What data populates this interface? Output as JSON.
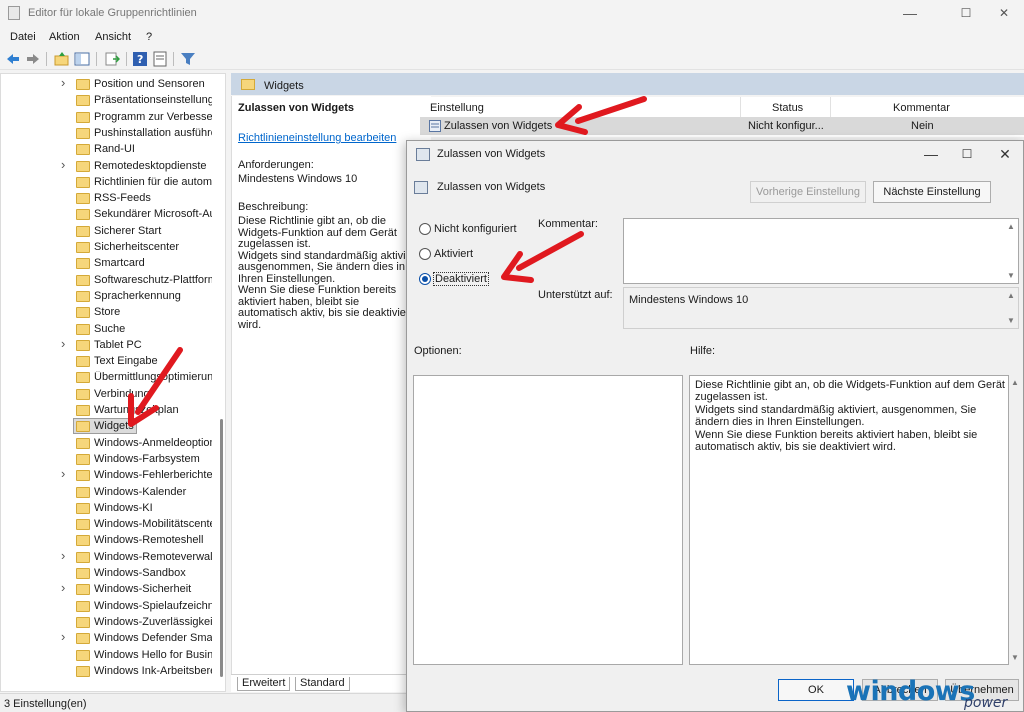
{
  "window": {
    "title": "Editor für lokale Gruppenrichtlinien",
    "minimize": "—",
    "maximize": "☐",
    "close": "✕"
  },
  "menu": {
    "file": "Datei",
    "action": "Aktion",
    "view": "Ansicht",
    "help": "?"
  },
  "tree": {
    "items": [
      {
        "label": "Position und Sensoren",
        "expandable": true
      },
      {
        "label": "Präsentationseinstellungen",
        "expandable": false
      },
      {
        "label": "Programm zur Verbesserung",
        "expandable": false
      },
      {
        "label": "Pushinstallation ausführen",
        "expandable": false
      },
      {
        "label": "Rand-UI",
        "expandable": false
      },
      {
        "label": "Remotedesktopdienste",
        "expandable": true
      },
      {
        "label": "Richtlinien für die automatische",
        "expandable": false
      },
      {
        "label": "RSS-Feeds",
        "expandable": false
      },
      {
        "label": "Sekundärer Microsoft-Authentifikator",
        "expandable": false
      },
      {
        "label": "Sicherer Start",
        "expandable": false
      },
      {
        "label": "Sicherheitscenter",
        "expandable": false
      },
      {
        "label": "Smartcard",
        "expandable": false
      },
      {
        "label": "Softwareschutz-Plattform",
        "expandable": false
      },
      {
        "label": "Spracherkennung",
        "expandable": false
      },
      {
        "label": "Store",
        "expandable": false
      },
      {
        "label": "Suche",
        "expandable": false
      },
      {
        "label": "Tablet PC",
        "expandable": true
      },
      {
        "label": "Text Eingabe",
        "expandable": false
      },
      {
        "label": "Übermittlungsoptimierung",
        "expandable": false
      },
      {
        "label": "Verbindung",
        "expandable": false
      },
      {
        "label": "Wartungszeitplan",
        "expandable": false
      },
      {
        "label": "Widgets",
        "expandable": false,
        "selected": true
      },
      {
        "label": "Windows-Anmeldeoptionen",
        "expandable": false
      },
      {
        "label": "Windows-Farbsystem",
        "expandable": false
      },
      {
        "label": "Windows-Fehlerberichterstattung",
        "expandable": true
      },
      {
        "label": "Windows-Kalender",
        "expandable": false
      },
      {
        "label": "Windows-KI",
        "expandable": false
      },
      {
        "label": "Windows-Mobilitätscenter",
        "expandable": false
      },
      {
        "label": "Windows-Remoteshell",
        "expandable": false
      },
      {
        "label": "Windows-Remoteverwaltung",
        "expandable": true
      },
      {
        "label": "Windows-Sandbox",
        "expandable": false
      },
      {
        "label": "Windows-Sicherheit",
        "expandable": true
      },
      {
        "label": "Windows-Spielaufzeichnung",
        "expandable": false
      },
      {
        "label": "Windows-Zuverlässigkeit",
        "expandable": false
      },
      {
        "label": "Windows Defender SmartScreen",
        "expandable": true
      },
      {
        "label": "Windows Hello for Business",
        "expandable": false
      },
      {
        "label": "Windows Ink-Arbeitsbereich",
        "expandable": false
      }
    ]
  },
  "middle": {
    "header": "Widgets",
    "policy_title": "Zulassen von Widgets",
    "edit_link": "Richtlinieneinstellung bearbeiten",
    "requirements_label": "Anforderungen:",
    "requirements_value": "Mindestens Windows 10",
    "description_label": "Beschreibung:",
    "description_lines": [
      "Diese Richtlinie gibt an, ob die",
      "Widgets-Funktion auf dem Gerät",
      "zugelassen ist.",
      "Widgets sind standardmäßig aktiviert,",
      "ausgenommen, Sie ändern dies in",
      "Ihren Einstellungen.",
      "Wenn Sie diese Funktion bereits",
      "aktiviert haben, bleibt sie",
      "automatisch aktiv, bis sie deaktiviert",
      "wird."
    ],
    "tabs": {
      "extended": "Erweitert",
      "standard": "Standard"
    }
  },
  "list": {
    "col_setting": "Einstellung",
    "col_status": "Status",
    "col_comment": "Kommentar",
    "row": {
      "name": "Zulassen von Widgets",
      "status": "Nicht konfigur...",
      "comment": "Nein"
    }
  },
  "status_bar": "3 Einstellung(en)",
  "dialog": {
    "title": "Zulassen von Widgets",
    "subtitle": "Zulassen von Widgets",
    "prev_button": "Vorherige Einstellung",
    "next_button": "Nächste Einstellung",
    "radio_not_configured": "Nicht konfiguriert",
    "radio_enabled": "Aktiviert",
    "radio_disabled": "Deaktiviert",
    "selected_state": "Deaktiviert",
    "comment_label": "Kommentar:",
    "supported_label": "Unterstützt auf:",
    "supported_value": "Mindestens Windows 10",
    "options_label": "Optionen:",
    "help_label": "Hilfe:",
    "help_text": "Diese Richtlinie gibt an, ob die Widgets-Funktion auf dem Gerät zugelassen ist.\nWidgets sind standardmäßig aktiviert, ausgenommen, Sie ändern dies in Ihren Einstellungen.\nWenn Sie diese Funktion bereits aktiviert haben, bleibt sie automatisch aktiv, bis sie deaktiviert wird.",
    "ok_button": "OK",
    "cancel_button": "Abbrechen",
    "apply_button": "Übernehmen"
  },
  "watermark": {
    "brand": "windows",
    "suffix": "power"
  },
  "colors": {
    "arrow": "#e0191f",
    "accent": "#0a4fa8",
    "header_band": "#c9d6e5",
    "link": "#0066cc"
  }
}
